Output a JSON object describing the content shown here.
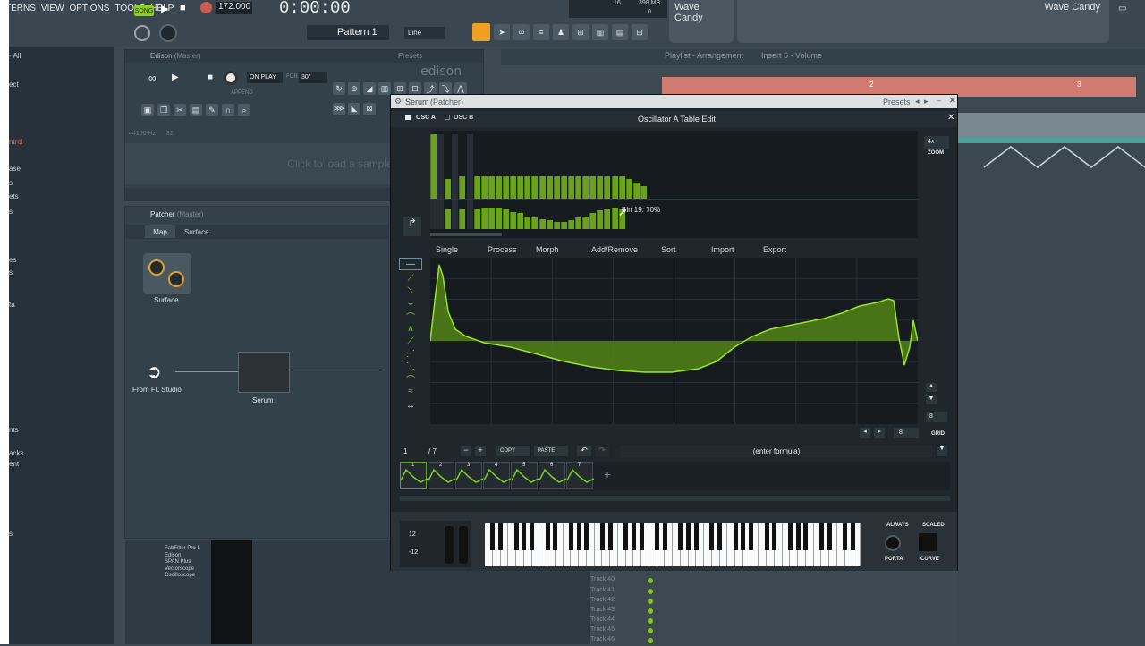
{
  "menu": {
    "items": [
      "TERNS",
      "VIEW",
      "OPTIONS",
      "TOOLS",
      "HELP"
    ]
  },
  "transport": {
    "song_label": "SONG",
    "tempo": "172.000",
    "time": "0:00:00"
  },
  "toolbar": {
    "pattern": "Pattern 1",
    "snap": "Line",
    "cpu_mem": "398 MB",
    "cpu_val": "16",
    "poly": "0"
  },
  "wave_candy": {
    "left": "Wave Candy",
    "right": "Wave Candy"
  },
  "left_browser": {
    "items": [
      "- All",
      "ect",
      "ntrol",
      "ase",
      "s",
      "ets",
      "s",
      "es",
      "s",
      "ta",
      "nts",
      "acks",
      "ent",
      "s"
    ]
  },
  "edison": {
    "title": "Edison",
    "master": "(Master)",
    "on_play": "ON PLAY",
    "for_label": "FOR",
    "for_val": "30'",
    "append": "APPEND",
    "samplerate": "44100 Hz",
    "bits": "32",
    "click_load": "Click to load a sample",
    "logo": "edison",
    "presets": "Presets"
  },
  "patcher": {
    "title": "Patcher",
    "master": "(Master)",
    "tab_map": "Map",
    "tab_surface": "Surface",
    "node_surface": "Surface",
    "node_fl": "From FL Studio",
    "node_serum": "Serum"
  },
  "playlist_bar": {
    "title": "Playlist - Arrangement",
    "insert": "Insert 6 - Volume",
    "marker2": "2",
    "marker3": "3"
  },
  "serum": {
    "window_title": "Serum",
    "patcher_tag": "(Patcher)",
    "presets": "Presets",
    "osc_a": "OSC A",
    "osc_b": "OSC B",
    "editor_title": "Oscillator A Table Edit",
    "zoom_val": "4x",
    "zoom_label": "ZOOM",
    "bin_tooltip": "Bin 19: 70%",
    "menu": [
      "Single",
      "Process",
      "Morph",
      "Add/Remove",
      "Sort",
      "Import",
      "Export"
    ],
    "grid_val": "8",
    "grid_label": "GRID",
    "grid_val2": "8",
    "frame_current": "1",
    "frame_total": "/ 7",
    "copy": "COPY",
    "paste": "PASTE",
    "formula": "(enter formula)",
    "thumbs": [
      "1",
      "2",
      "3",
      "4",
      "5",
      "6",
      "7"
    ],
    "add_frame": "+",
    "pitch_up": "12",
    "pitch_down": "-12",
    "always": "ALWAYS",
    "scaled": "SCALED",
    "porta": "PORTA",
    "curve": "CURVE"
  },
  "mixer": {
    "plugins": [
      "FabFilter Pro-L",
      "Edison",
      "SPAN Plus",
      "Vectorscope",
      "Oscilloscope"
    ]
  },
  "tracks": [
    "Track 40",
    "Track 41",
    "Track 42",
    "Track 43",
    "Track 44",
    "Track 45",
    "Track 46"
  ],
  "bins_top": [
    100,
    0,
    30,
    0,
    35,
    0,
    35,
    35,
    35,
    35,
    35,
    35,
    35,
    35,
    35,
    35,
    35,
    35,
    35,
    35,
    35,
    35,
    35,
    35,
    35,
    35,
    35,
    30,
    25,
    20
  ],
  "bins_bottom": [
    0,
    0,
    70,
    0,
    70,
    0,
    70,
    75,
    75,
    75,
    70,
    60,
    55,
    45,
    40,
    35,
    30,
    25,
    25,
    30,
    40,
    45,
    55,
    65,
    70,
    75,
    70
  ]
}
